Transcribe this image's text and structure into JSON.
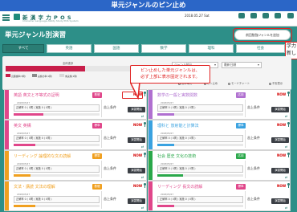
{
  "banner": {
    "title": "単元ジャンルのピン止め"
  },
  "header": {
    "logo_text": "新 漢 字 力 P O S",
    "logo_sub": "Character Language Ability Study POS System",
    "date": "2018.05.27 Sat",
    "icons": [
      {
        "name": "chat-icon",
        "label": ""
      },
      {
        "name": "list-icon",
        "label": ""
      },
      {
        "name": "trophy-icon",
        "label": ""
      },
      {
        "name": "gear-icon",
        "label": ""
      },
      {
        "name": "mail-icon",
        "label": ""
      }
    ]
  },
  "page": {
    "title": "単元ジャンル別演習",
    "history_button": "前回勉強ジャンルを追加",
    "side_note": "学力\n新し"
  },
  "tabs": [
    "すべて",
    "英語",
    "国語",
    "数学",
    "理科",
    "社会"
  ],
  "stats": {
    "label": "全体進捗",
    "progress": 0.62,
    "legend": [
      "克服確率(3問)",
      "実施の率(1問)",
      "未実施(1問)"
    ],
    "select_genre": "ジャンル絞込",
    "select_order": "最新日順",
    "radio_options": [
      "苦手単元",
      "ピン止め",
      "モードチャート"
    ],
    "radio_right": "不安表示"
  },
  "callout": {
    "line1": "ピン止めした単元ジャンルは、",
    "line2": "必ず上部に表示固定されます。"
  },
  "cards": [
    {
      "subject": "英語",
      "title": "英語 英文と不等式の証明",
      "level": "基礎",
      "tag": "NOW",
      "date": "2018/05/27",
      "info": "正解率 0 ( 0問 ) 実施 0 ( 0問 )",
      "mode": "苦上条件",
      "button": "演習開始",
      "progress": 0.35
    },
    {
      "subject": "数学",
      "title": "数学の一般と実数関数",
      "level": "応用",
      "tag": "NOW",
      "date": "2018/05/27",
      "info": "正解率 0 ( 0問 ) 実施 0 ( 0問 )",
      "mode": "苦上条件",
      "button": "演習開始",
      "progress": 0.2
    },
    {
      "subject": "英語",
      "title": "英文 英構",
      "level": "標準",
      "tag": "NOW",
      "date": "2018/05/27",
      "info": "正解率 0 ( 0問 ) 実施 0 ( 0問 )",
      "mode": "苦上条件",
      "button": "演習開始",
      "progress": 0.25
    },
    {
      "subject": "理科",
      "title": "理科と 放射能と計算法",
      "level": "標準",
      "tag": "NOW",
      "date": "2018/05/27",
      "info": "正解率 0 ( 0問 ) 実施 0 ( 0問 )",
      "mode": "苦上条件",
      "button": "演習開始",
      "progress": 0.2
    },
    {
      "subject": "国語",
      "title": "リーディング 論理的な文の読解",
      "level": "標準",
      "tag": "NOW",
      "date": "2018/05/27",
      "info": "正解率 0 ( 0問 ) 実施 0 ( 0問 )",
      "mode": "苦上条件",
      "button": "演習開始",
      "progress": 0.2
    },
    {
      "subject": "社会",
      "title": "社会 歴史 文化の技術",
      "level": "応用",
      "tag": "NOW",
      "date": "2018/05/27",
      "info": "正解率 0 ( 0問 ) 実施 0 ( 0問 )",
      "mode": "苦上条件",
      "button": "演習開始",
      "progress": 0.3
    },
    {
      "subject": "国語",
      "title": "文法・講読 文法の理解",
      "level": "基礎",
      "tag": "NOW",
      "date": "2018/05/27",
      "info": "正解率 0 ( 0問 ) 実施 0 ( 0問 )",
      "mode": "苦上条件",
      "button": "演習開始",
      "progress": 0.25
    },
    {
      "subject": "英語",
      "title": "リーディング 長文の読解",
      "level": "標準",
      "tag": "NOW",
      "date": "2018/05/27",
      "info": "正解率 0 ( 0問 ) 実施 0 ( 0問 )",
      "mode": "苦上条件",
      "button": "演習開始",
      "progress": 0.2
    }
  ],
  "colors": {
    "teal": "#2d8f88",
    "banner_blue": "#2b66c7",
    "callout_red": "#e02424",
    "subject": {
      "英語": "#e0468a",
      "数学": "#b070d0",
      "理科": "#3aa2e0",
      "国語": "#f0a020",
      "社会": "#2aa84a"
    }
  }
}
